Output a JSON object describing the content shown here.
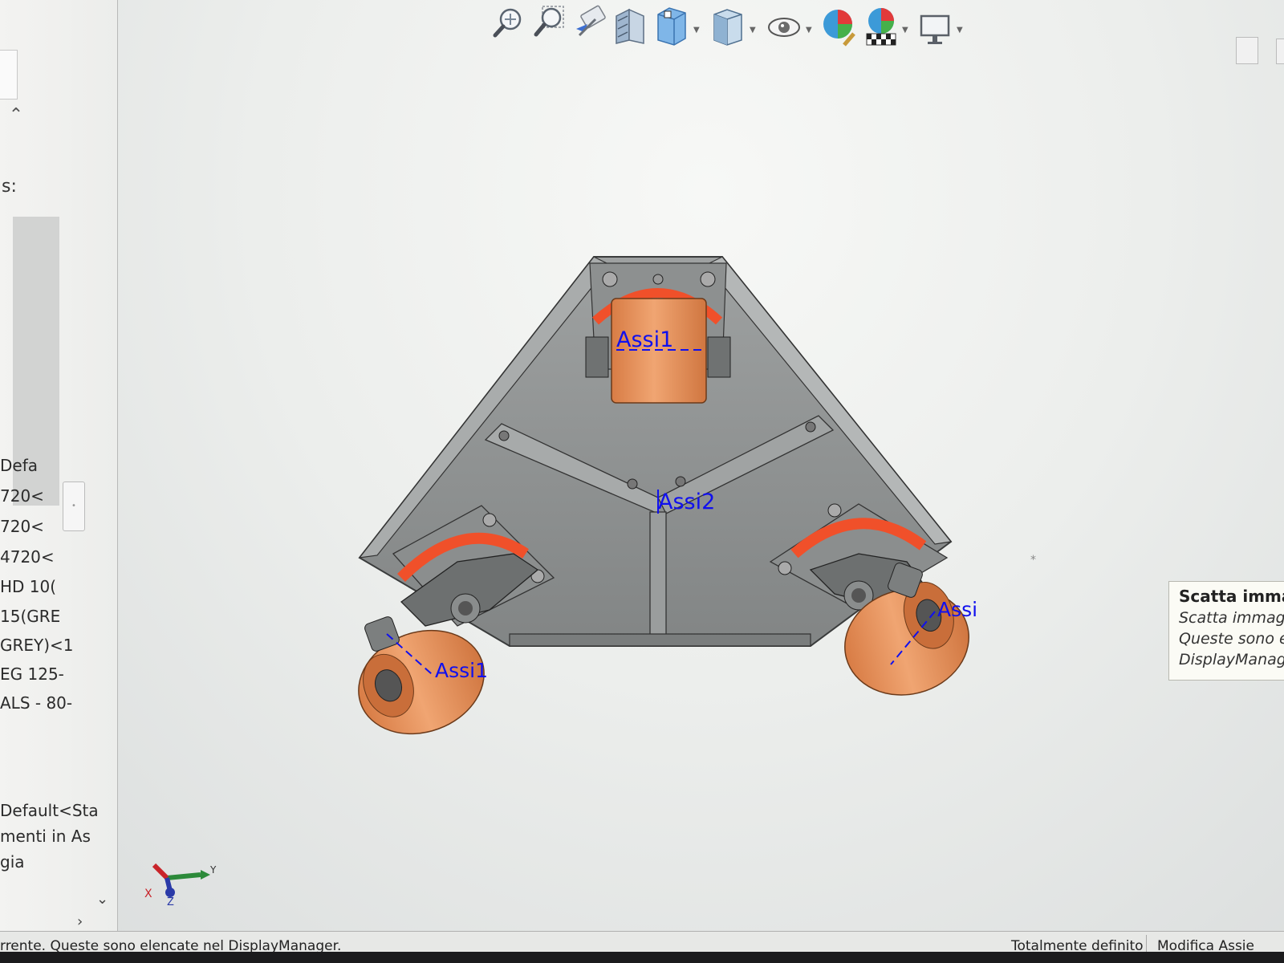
{
  "feature_tree": {
    "partial_label": "s:",
    "items": [
      "Defa",
      "720<",
      "720<",
      "4720<",
      "HD 10(",
      "15(GRE",
      "GREY)<1",
      "EG 125-",
      "ALS - 80-",
      "Default<Sta",
      "menti in As",
      "gia"
    ]
  },
  "toolbar": {
    "icons": [
      "zoom-to-fit-icon",
      "zoom-area-icon",
      "previous-view-icon",
      "section-view-icon",
      "view-orientation-icon",
      "display-style-icon",
      "hide-show-icon",
      "edit-appearance-icon",
      "apply-scene-icon",
      "view-settings-icon"
    ]
  },
  "viewport": {
    "axis_labels": {
      "top": "Assi1",
      "center": "Assi2",
      "left": "Assi1",
      "right": "Assi1"
    },
    "triad": {
      "y": "Y",
      "x": "X",
      "z": "Z"
    },
    "colors": {
      "frame": "#8c8f8f",
      "wheel": "#e8915a",
      "wheel_ring": "#f0502a",
      "axis": "#1010ee"
    }
  },
  "tooltip": {
    "title": "Scatta imma",
    "lines": [
      "Scatta immag",
      "Queste sono e",
      "DisplayManage"
    ]
  },
  "status_bar": {
    "message": "rrente. Queste sono elencate nel DisplayManager.",
    "definition": "Totalmente definito",
    "mode": "Modifica Assie"
  }
}
